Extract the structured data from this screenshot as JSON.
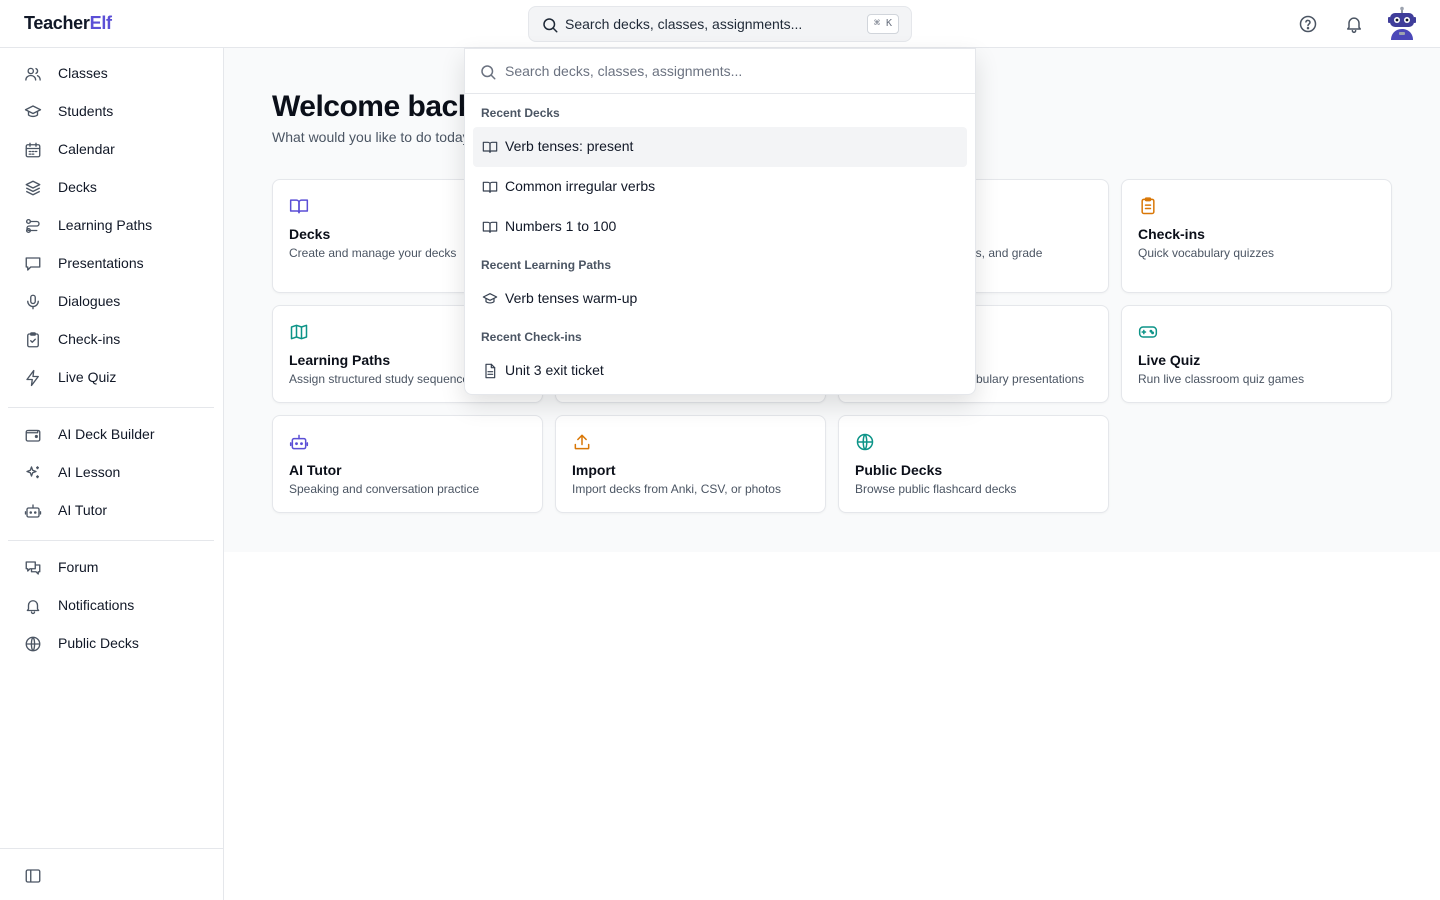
{
  "header": {
    "logo_main": "Teacher",
    "logo_accent": "Elf",
    "search_placeholder": "Search decks, classes, assignments...",
    "shortcut": "⌘ K",
    "icons": [
      "help-icon",
      "bell-icon",
      "robot-avatar"
    ]
  },
  "sidebar": {
    "primary": [
      {
        "label": "Classes",
        "icon": "users-icon"
      },
      {
        "label": "Students",
        "icon": "graduation-cap-icon"
      },
      {
        "label": "Calendar",
        "icon": "calendar-icon"
      },
      {
        "label": "Decks",
        "icon": "layers-icon"
      },
      {
        "label": "Learning Paths",
        "icon": "route-icon"
      },
      {
        "label": "Presentations",
        "icon": "presentation-icon"
      },
      {
        "label": "Dialogues",
        "icon": "microphone-icon"
      },
      {
        "label": "Check-ins",
        "icon": "clipboard-check-icon"
      },
      {
        "label": "Live Quiz",
        "icon": "lightning-icon"
      }
    ],
    "ai": [
      {
        "label": "AI Deck Builder",
        "icon": "wallet-icon"
      },
      {
        "label": "AI Lesson",
        "icon": "sparkles-icon"
      },
      {
        "label": "AI Tutor",
        "icon": "bot-icon"
      }
    ],
    "community": [
      {
        "label": "Forum",
        "icon": "chat-icon"
      },
      {
        "label": "Notifications",
        "icon": "bell-icon"
      },
      {
        "label": "Public Decks",
        "icon": "globe-icon"
      }
    ]
  },
  "main": {
    "welcome": "Welcome back",
    "subtitle": "What would you like to do today?",
    "cards": [
      {
        "title": "Decks",
        "desc": "Create and manage your decks",
        "icon": "book-open-icon",
        "color": "#5b4fd6"
      },
      {
        "title": "",
        "desc": "ents, and grade",
        "icon": "",
        "color": ""
      },
      {
        "title": "Check-ins",
        "desc": "Quick vocabulary quizzes",
        "icon": "clipboard-icon",
        "color": "#d97706"
      },
      {
        "title": "Learning Paths",
        "desc": "Assign structured study sequences",
        "icon": "map-icon",
        "color": "#0d9488"
      },
      {
        "title": "",
        "desc": "bulary presentations",
        "icon": "",
        "color": ""
      },
      {
        "title": "Live Quiz",
        "desc": "Run live classroom quiz games",
        "icon": "gamepad-icon",
        "color": "#0d9488"
      },
      {
        "title": "AI Tutor",
        "desc": "Speaking and conversation practice",
        "icon": "bot-icon",
        "color": "#5b4fd6"
      },
      {
        "title": "Import",
        "desc": "Import decks from Anki, CSV, or photos",
        "icon": "upload-icon",
        "color": "#d97706"
      },
      {
        "title": "Public Decks",
        "desc": "Browse public flashcard decks",
        "icon": "globe-icon",
        "color": "#0d9488"
      }
    ]
  },
  "dropdown": {
    "placeholder": "Search decks, classes, assignments...",
    "groups": [
      {
        "label": "Recent Decks",
        "items": [
          "Verb tenses: present",
          "Common irregular verbs",
          "Numbers 1 to 100"
        ]
      },
      {
        "label": "Recent Learning Paths",
        "items": [
          "Verb tenses warm-up"
        ]
      },
      {
        "label": "Recent Check-ins",
        "items": [
          "Unit 3 exit ticket"
        ]
      }
    ]
  }
}
